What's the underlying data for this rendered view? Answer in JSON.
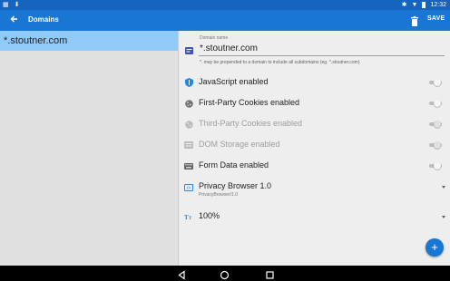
{
  "status_bar": {
    "carrier": "",
    "time": "12:32"
  },
  "app_bar": {
    "title": "Domains",
    "save_label": "SAVE"
  },
  "domains_list": [
    {
      "name": "*.stoutner.com",
      "selected": true
    }
  ],
  "settings": {
    "domain_name_label": "Domain name",
    "domain_name_value": "*.stoutner.com",
    "domain_hint": "*. may be prepended to a domain to include all subdomains (eg. *.stoutner.com)",
    "toggles": [
      {
        "label": "JavaScript enabled",
        "icon": "javascript-shield-icon",
        "enabled": false,
        "disabled": false
      },
      {
        "label": "First-Party Cookies enabled",
        "icon": "cookie-icon",
        "enabled": false,
        "disabled": false
      },
      {
        "label": "Third-Party Cookies enabled",
        "icon": "cookie-icon",
        "enabled": false,
        "disabled": true
      },
      {
        "label": "DOM Storage enabled",
        "icon": "dom-storage-icon",
        "enabled": false,
        "disabled": true
      },
      {
        "label": "Form Data enabled",
        "icon": "keyboard-icon",
        "enabled": false,
        "disabled": false
      }
    ],
    "user_agent": {
      "label": "Privacy Browser 1.0",
      "value": "PrivacyBrowser/1.0"
    },
    "font_size": {
      "label": "100%"
    }
  },
  "fab_symbol": "+",
  "colors": {
    "app_bar": "#1976d2",
    "status_bar": "#1565c0",
    "selected_item": "#90caf9",
    "accent": "#1976d2"
  }
}
